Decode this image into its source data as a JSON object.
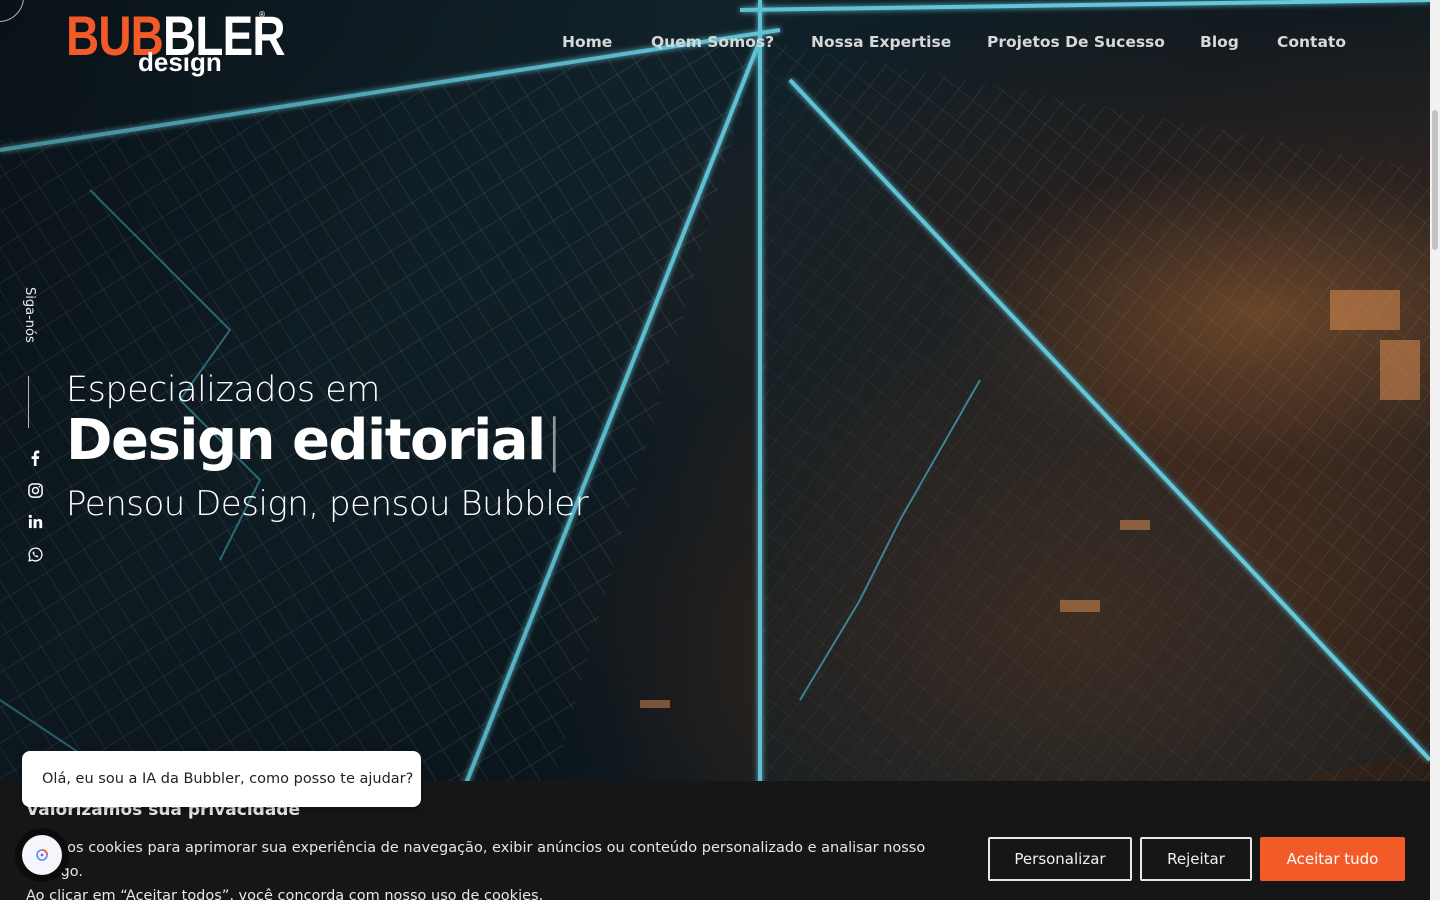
{
  "header": {
    "logo": {
      "main_orange": "BUB",
      "main_white": "BLER",
      "sub": "design",
      "registered": "®"
    },
    "nav": [
      {
        "label": "Home"
      },
      {
        "label": "Quem Somos?"
      },
      {
        "label": "Nossa Expertise"
      },
      {
        "label": "Projetos De Sucesso"
      },
      {
        "label": "Blog"
      },
      {
        "label": "Contato"
      }
    ]
  },
  "social": {
    "label": "Siga-nós",
    "icons": [
      "facebook-icon",
      "instagram-icon",
      "linkedin-icon",
      "whatsapp-icon"
    ]
  },
  "hero": {
    "subtitle": "Especializados em",
    "headline": "Design editorial",
    "cursor": "|",
    "tagline": "Pensou Design, pensou Bubbler"
  },
  "cookie_banner": {
    "title": "Valorizamos sua privacidade",
    "text_line1": "Usamos cookies para aprimorar sua experiência de navegação, exibir anúncios ou conteúdo personalizado e analisar nosso tráfego.",
    "text_line2": "Ao clicar em “Aceitar todos”, você concorda com nosso uso de cookies.",
    "buttons": {
      "customize": "Personalizar",
      "reject": "Rejeitar",
      "accept": "Aceitar tudo"
    }
  },
  "chat": {
    "greeting": "Olá, eu sou a IA da Bubbler, como posso te ajudar?"
  },
  "colors": {
    "accent": "#f25a28",
    "banner_bg": "#161616",
    "glass_cyan": "#5fd6f0"
  }
}
